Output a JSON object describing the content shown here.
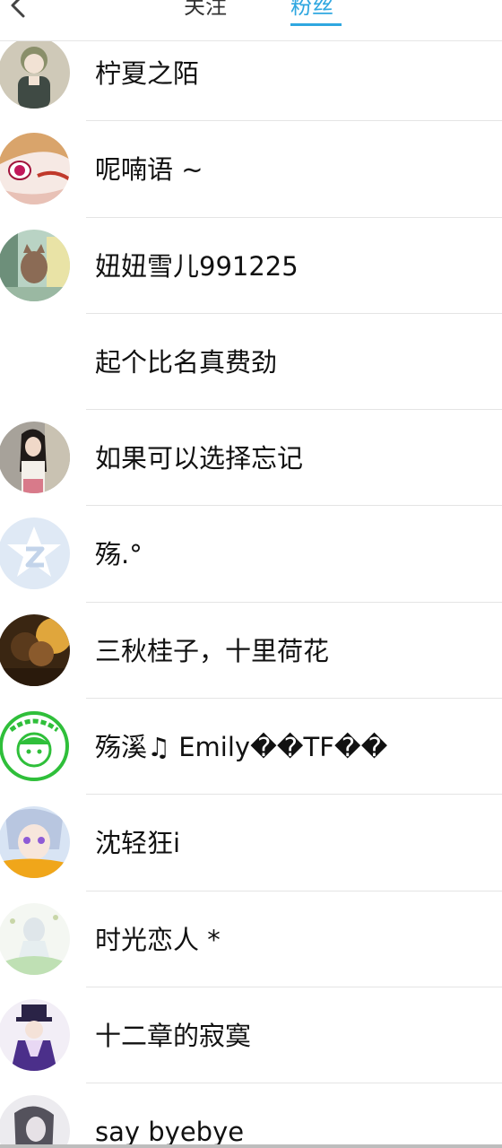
{
  "header": {
    "back_icon": "chevron-left-icon",
    "tabs": [
      {
        "label": "关注",
        "active": false
      },
      {
        "label": "粉丝",
        "active": true
      }
    ],
    "accent_color": "#2fa7e0"
  },
  "fans": [
    {
      "name": "柠夏之陌",
      "avatar": "avatar-girl-green-hair"
    },
    {
      "name": "呢喃语 ~",
      "avatar": "avatar-anime-red-eye"
    },
    {
      "name": "妞妞雪儿991225",
      "avatar": "avatar-cat-photo"
    },
    {
      "name": "起个比名真费劲",
      "avatar": "none"
    },
    {
      "name": "如果可以选择忘记",
      "avatar": "avatar-girl-photo"
    },
    {
      "name": "殇.°",
      "avatar": "avatar-default-qzone"
    },
    {
      "name": "三秋桂子，十里荷花",
      "avatar": "avatar-couple-photo"
    },
    {
      "name": "殇溪♫ Emily��TF��",
      "avatar": "avatar-green-cartoon-badge"
    },
    {
      "name": "沈轻狂i",
      "avatar": "avatar-anime-silver-hair"
    },
    {
      "name": "时光恋人 *",
      "avatar": "avatar-sketch-girl"
    },
    {
      "name": "十二章的寂寞",
      "avatar": "avatar-anime-purple-hat"
    },
    {
      "name": "say byebye",
      "avatar": "avatar-dark-hair-sketch"
    }
  ]
}
